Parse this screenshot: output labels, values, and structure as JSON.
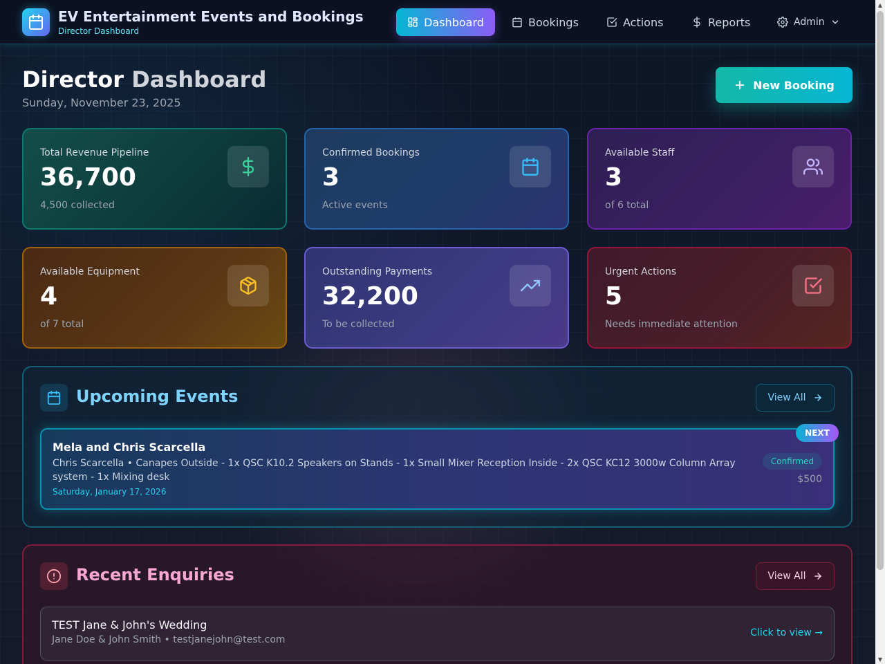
{
  "app": {
    "title": "EV Entertainment Events and Bookings",
    "subtitle": "Director Dashboard",
    "logo_icon": "calendar-icon"
  },
  "nav": [
    {
      "label": "Dashboard",
      "icon": "dashboard-icon",
      "active": true
    },
    {
      "label": "Bookings",
      "icon": "calendar-icon",
      "active": false
    },
    {
      "label": "Actions",
      "icon": "checkbox-icon",
      "active": false
    },
    {
      "label": "Reports",
      "icon": "dollar-icon",
      "active": false
    },
    {
      "label": "Admin",
      "icon": "gear-icon",
      "active": false
    }
  ],
  "header": {
    "title_first": "Director",
    "title_second": "Dashboard",
    "date": "Sunday, November 23, 2025",
    "new_booking_label": "New Booking"
  },
  "stats": [
    {
      "label": "Total Revenue Pipeline",
      "value": "36,700",
      "sub": "4,500 collected",
      "icon": "dollar-icon",
      "accent": "#34d399"
    },
    {
      "label": "Confirmed Bookings",
      "value": "3",
      "sub": "Active events",
      "icon": "calendar-icon",
      "accent": "#38bdf8"
    },
    {
      "label": "Available Staff",
      "value": "3",
      "sub": "of 6 total",
      "icon": "users-icon",
      "accent": "#c4b5fd"
    },
    {
      "label": "Available Equipment",
      "value": "4",
      "sub": "of 7 total",
      "icon": "box-icon",
      "accent": "#fbbf24"
    },
    {
      "label": "Outstanding Payments",
      "value": "32,200",
      "sub": "To be collected",
      "icon": "trending-up-icon",
      "accent": "#93c5fd"
    },
    {
      "label": "Urgent Actions",
      "value": "5",
      "sub": "Needs immediate attention",
      "icon": "checkbox-icon",
      "accent": "#fb7185"
    }
  ],
  "upcoming": {
    "title": "Upcoming Events",
    "view_all": "View All",
    "accent": "#7dd3fc",
    "events": [
      {
        "badge": "NEXT",
        "title": "Mela and Chris Scarcella",
        "description": "Chris Scarcella • Canapes Outside - 1x QSC K10.2 Speakers on Stands - 1x Small Mixer Reception Inside - 2x QSC KC12 3000w Column Array system - 1x Mixing desk",
        "date": "Saturday, January 17, 2026",
        "status": "Confirmed",
        "price": "$500"
      }
    ]
  },
  "enquiries": {
    "title": "Recent Enquiries",
    "view_all": "View All",
    "accent": "#f9a8d4",
    "items": [
      {
        "title": "TEST Jane & John's Wedding",
        "subtitle": "Jane Doe & John Smith • testjanejohn@test.com",
        "link": "Click to view →"
      }
    ]
  }
}
